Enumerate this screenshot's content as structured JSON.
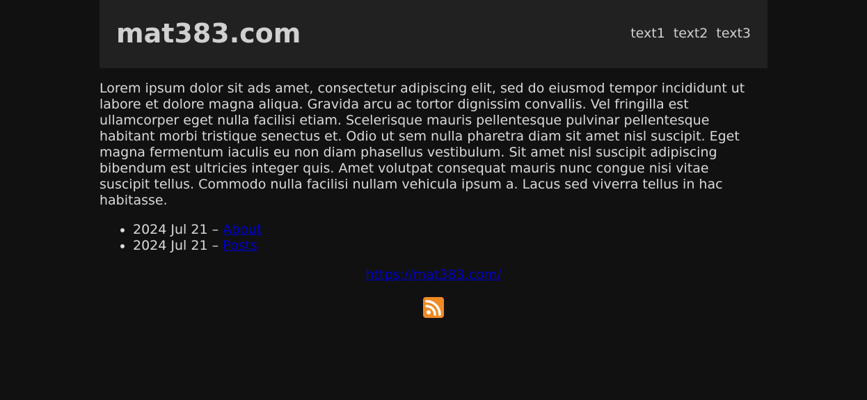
{
  "header": {
    "title": "mat383.com",
    "nav": [
      "text1",
      "text2",
      "text3"
    ]
  },
  "main": {
    "intro": "Lorem ipsum dolor sit ads amet, consectetur adipiscing elit, sed do eiusmod tempor incididunt ut labore et dolore magna aliqua. Gravida arcu ac tortor dignissim convallis. Vel fringilla est ullamcorper eget nulla facilisi etiam. Scelerisque mauris pellentesque pulvinar pellentesque habitant morbi tristique senectus et. Odio ut sem nulla pharetra diam sit amet nisl suscipit. Eget magna fermentum iaculis eu non diam phasellus vestibulum. Sit amet nisl suscipit adipiscing bibendum est ultricies integer quis. Amet volutpat consequat mauris nunc congue nisi vitae suscipit tellus. Commodo nulla facilisi nullam vehicula ipsum a. Lacus sed viverra tellus in hac habitasse.",
    "posts": [
      {
        "date": "2024 Jul 21",
        "separator": " – ",
        "link": "About"
      },
      {
        "date": "2024 Jul 21",
        "separator": " – ",
        "link": "Posts"
      }
    ]
  },
  "footer": {
    "url": "https://mat383.com/",
    "rss_icon": "rss-icon"
  },
  "colors": {
    "background": "#111111",
    "header_background": "#212121",
    "text": "#d9d9d9",
    "link": "#0000cc",
    "rss": "#f08a24"
  }
}
